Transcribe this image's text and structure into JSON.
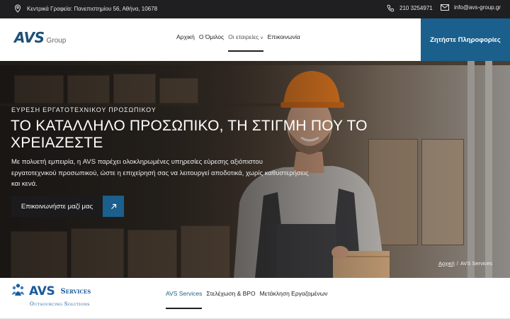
{
  "topbar": {
    "address": "Κεντρικά Γραφεία: Πανεπιστημίου 56, Αθήνα, 10678",
    "phone": "210 3254971",
    "email": "info@avs-group.gr",
    "icons": [
      "location-pin-icon",
      "phone-icon",
      "envelope-icon"
    ]
  },
  "header": {
    "logo_main": "AVS",
    "logo_sub": "Group",
    "nav": [
      {
        "label": "Αρχική"
      },
      {
        "label": "Ο Όμιλος"
      },
      {
        "label": "Οι εταιρείες"
      },
      {
        "label": "Επικοινωνία"
      }
    ],
    "cta": "Ζητήστε Πληροφορίες"
  },
  "hero": {
    "kicker": "ΕΥΡΕΣΗ ΕΡΓΑΤΟΤΕΧΝΙΚΟΥ ΠΡΟΣΩΠΙΚΟΥ",
    "headline": "ΤΟ ΚΑΤΑΛΛΗΛΟ ΠΡΟΣΩΠΙΚΟ, ΤΗ ΣΤΙΓΜΗ ΠΟΥ ΤΟ ΧΡΕΙΑΖΕΣΤΕ",
    "description": "Με πολυετή εμπειρία, η AVS παρέχει ολοκληρωμένες υπηρεσίες εύρεσης αξιόπιστου εργατοτεχνικού προσωπικού, ώστε η επιχείρησή σας να λειτουργεί αποδοτικά, χωρίς καθυστερήσεις και κενά.",
    "button_label": "Επικοινωνήστε μαζί μας",
    "breadcrumb_home": "Αρχική",
    "breadcrumb_sep": "/",
    "breadcrumb_current": "AVS Services"
  },
  "services_bar": {
    "logo_main": "AVS",
    "logo_services": "Services",
    "logo_tagline": "Outsourcing Solutions",
    "tabs": [
      {
        "label": "AVS Services"
      },
      {
        "label": "Στελέχωση & BPO"
      },
      {
        "label": "Μετάκληση Εργαζομένων"
      }
    ]
  },
  "colors": {
    "brand_blue": "#1b5f8c",
    "dark_bar": "#1f1f21",
    "helmet_orange": "#e87a1e"
  }
}
